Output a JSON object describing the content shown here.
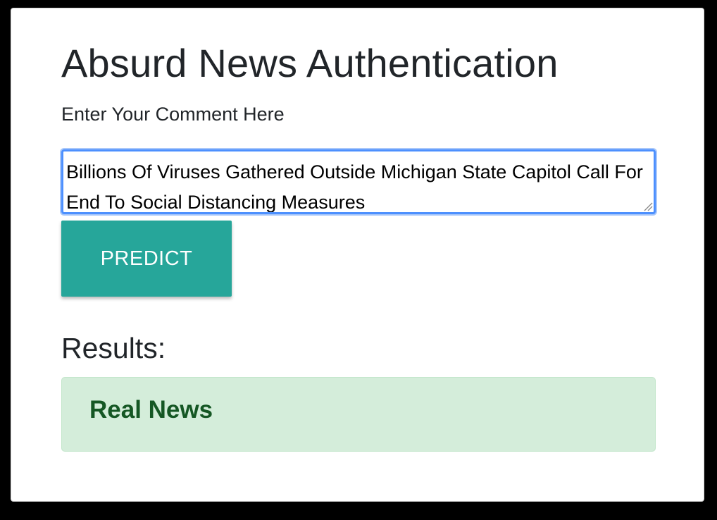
{
  "page": {
    "title": "Absurd News Authentication"
  },
  "form": {
    "label": "Enter Your Comment Here",
    "comment_value": "Billions Of Viruses Gathered Outside Michigan State Capitol Call For End To Social Distancing Measures",
    "predict_label": "PREDICT"
  },
  "results": {
    "heading": "Results:",
    "prediction": "Real News"
  },
  "colors": {
    "button_bg": "#26a69a",
    "alert_bg": "#d4edda",
    "alert_text": "#155724",
    "focus_border": "#4d90fe"
  }
}
